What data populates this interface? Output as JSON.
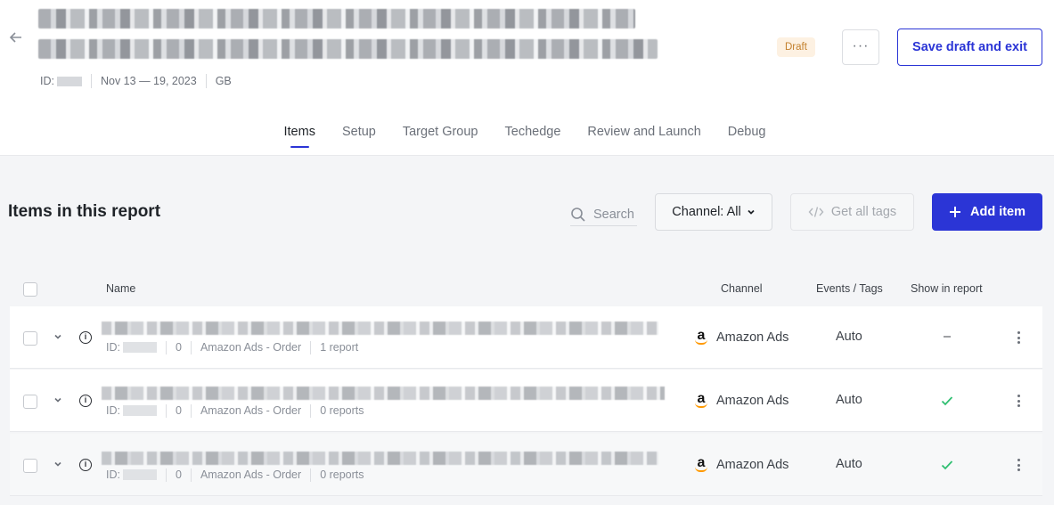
{
  "header": {
    "status_badge": "Draft",
    "more_label": "···",
    "save_label": "Save draft and exit",
    "meta": {
      "id_label": "ID:",
      "date_range": "Nov 13 — 19, 2023",
      "region": "GB"
    }
  },
  "tabs": [
    {
      "label": "Items",
      "active": true
    },
    {
      "label": "Setup"
    },
    {
      "label": "Target Group"
    },
    {
      "label": "Techedge"
    },
    {
      "label": "Review and Launch"
    },
    {
      "label": "Debug"
    }
  ],
  "section": {
    "title": "Items in this report",
    "search_label": "Search",
    "channel_filter_label": "Channel: All",
    "get_tags_label": "Get all tags",
    "add_item_label": "Add item"
  },
  "table": {
    "columns": {
      "name": "Name",
      "channel": "Channel",
      "events": "Events / Tags",
      "show": "Show in report"
    },
    "rows": [
      {
        "id_label": "ID:",
        "count": "0",
        "type": "Amazon Ads - Order",
        "reports": "1 report",
        "channel": "Amazon Ads",
        "events": "Auto",
        "show": "–",
        "show_checked": false
      },
      {
        "id_label": "ID:",
        "count": "0",
        "type": "Amazon Ads - Order",
        "reports": "0 reports",
        "channel": "Amazon Ads",
        "events": "Auto",
        "show": "",
        "show_checked": true
      },
      {
        "id_label": "ID:",
        "count": "0",
        "type": "Amazon Ads - Order",
        "reports": "0 reports",
        "channel": "Amazon Ads",
        "events": "Auto",
        "show": "",
        "show_checked": true
      }
    ]
  },
  "colors": {
    "accent": "#2b35d6",
    "draft_badge_bg": "#fdf1e2",
    "draft_badge_text": "#c4812e",
    "check_green": "#2fbf71",
    "amazon_orange": "#ff9900"
  },
  "icons": {
    "back": "arrow-left-icon",
    "search": "search-icon",
    "channel_dropdown": "chevron-down-icon",
    "get_tags": "code-icon",
    "add": "plus-icon",
    "row_expand": "chevron-down-icon",
    "row_info": "info-icon",
    "channel": "amazon-icon",
    "show_yes": "check-icon",
    "row_menu": "kebab-menu-icon"
  }
}
